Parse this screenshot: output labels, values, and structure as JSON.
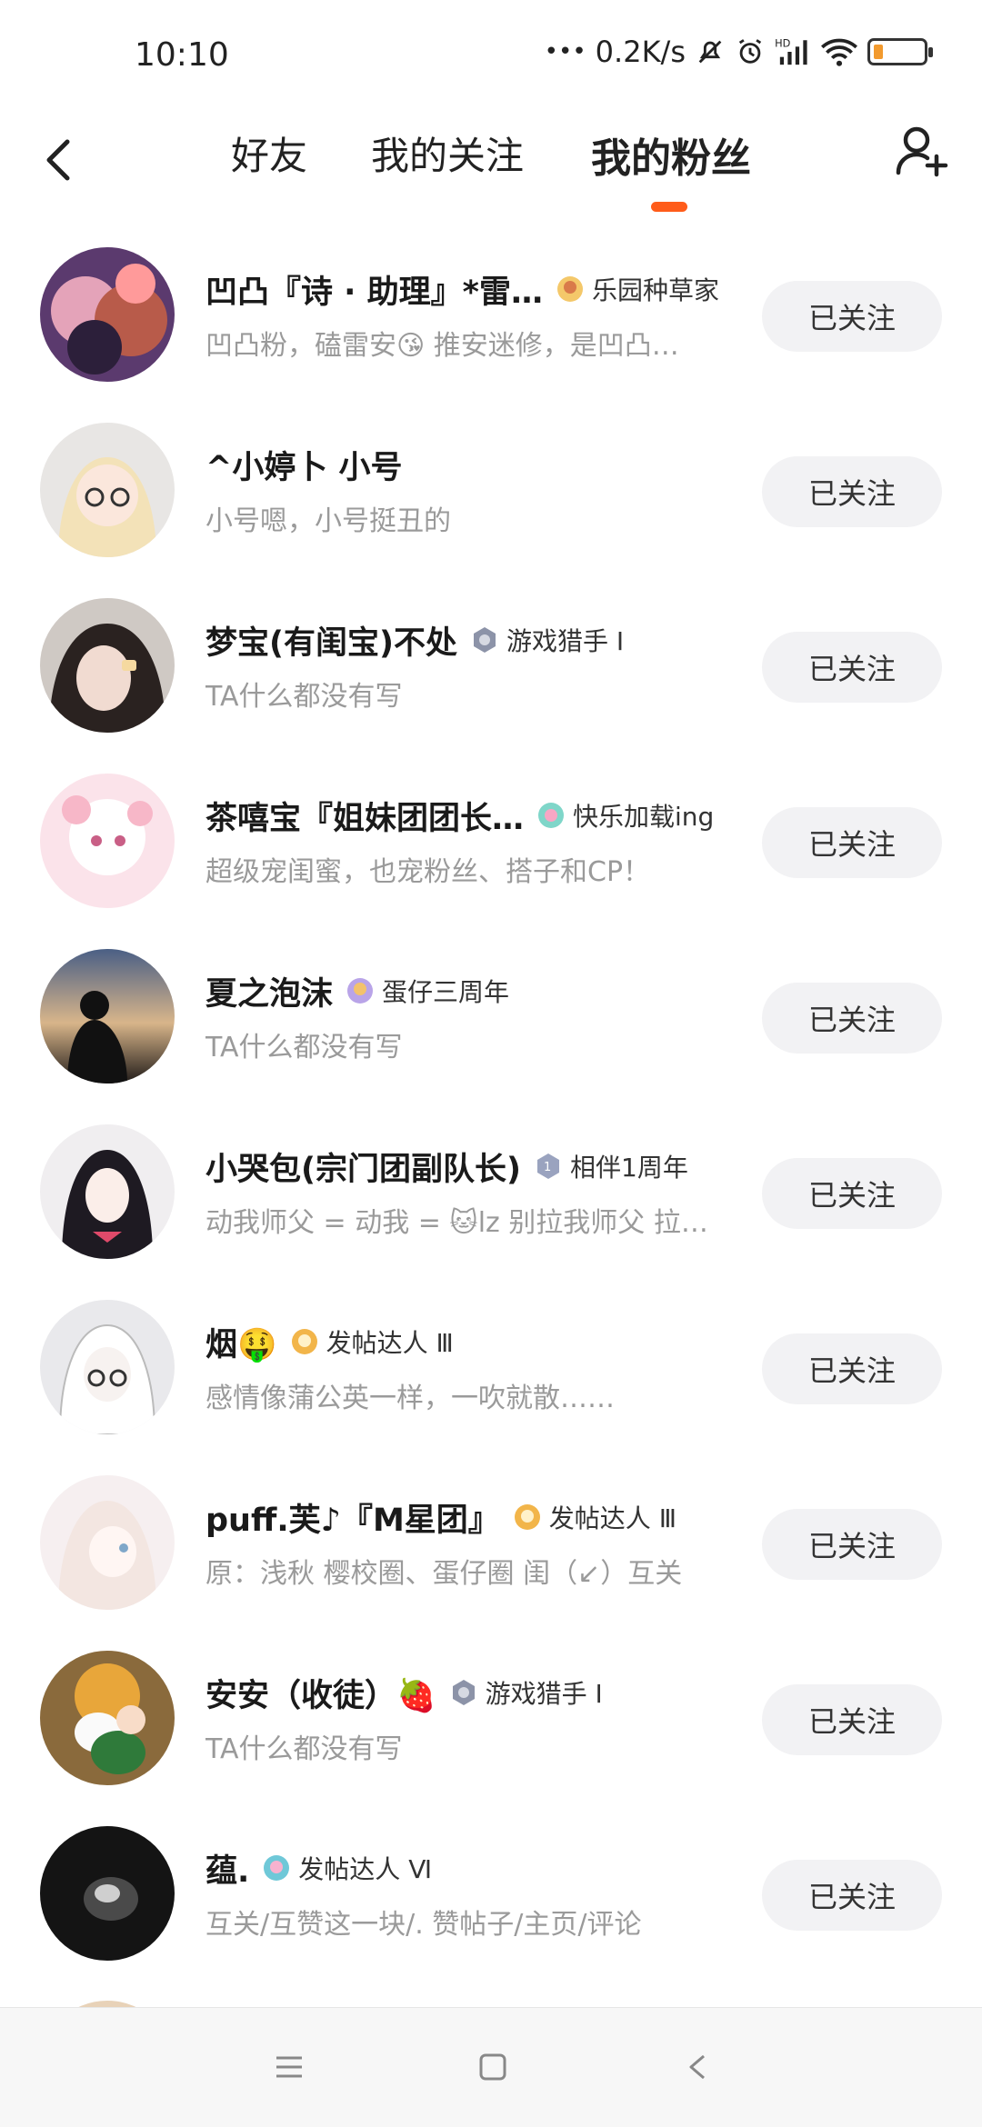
{
  "status_bar": {
    "time": "10:10",
    "speed": "0.2K/s",
    "dots": "•••",
    "icons": [
      "mute-icon",
      "alarm-icon",
      "signal-hd-icon",
      "wifi-icon",
      "battery-icon"
    ]
  },
  "header": {
    "back_icon": "chevron-left-icon",
    "tabs": [
      {
        "label": "好友",
        "active": false
      },
      {
        "label": "我的关注",
        "active": false
      },
      {
        "label": "我的粉丝",
        "active": true
      }
    ],
    "add_friend_icon": "add-user-icon",
    "accent_color": "#ff5c1a"
  },
  "fans": [
    {
      "name": "凹凸『诗 · 助理』*雷…",
      "medal": "乐园种草家",
      "bio": "凹凸粉，磕雷安😘 推安迷修，是凹凸…",
      "button": "已关注"
    },
    {
      "name": "^小婷卜 小号",
      "medal": "",
      "bio": "小号嗯，小号挺丑的",
      "button": "已关注"
    },
    {
      "name": "梦宝(有闺宝)不处",
      "medal": "游戏猎手 Ⅰ",
      "bio": "TA什么都没有写",
      "button": "已关注"
    },
    {
      "name": "茶嘻宝『姐妹团团长…",
      "medal": "快乐加载ing",
      "bio": "超级宠闺蜜，也宠粉丝、搭子和CP！",
      "button": "已关注"
    },
    {
      "name": "夏之泡沫",
      "medal": "蛋仔三周年",
      "bio": "TA什么都没有写",
      "button": "已关注"
    },
    {
      "name": "小哭包(宗门团副队长)",
      "medal": "相伴1周年",
      "bio": "动我师父 = 动我 = 🐱lz 别拉我师父 拉…",
      "button": "已关注"
    },
    {
      "name": "烟🤑",
      "medal": "发帖达人 Ⅲ",
      "bio": "感情像蒲公英一样，一吹就散……",
      "button": "已关注"
    },
    {
      "name": " puff.芙♪『M星团』",
      "medal": "发帖达人 Ⅲ",
      "bio": "原：浅秋 樱校圈、蛋仔圈 闺（↙）互关",
      "button": "已关注"
    },
    {
      "name": "安安（收徒）🍓",
      "medal": "游戏猎手 Ⅰ",
      "bio": "TA什么都没有写",
      "button": "已关注"
    },
    {
      "name": "蕴.",
      "medal": "发帖达人 Ⅵ",
      "bio": "互关/互赞这一块/. 赞帖子/主页/评论",
      "button": "已关注"
    }
  ],
  "nav_bar": {
    "icons": [
      "menu-icon",
      "home-square-icon",
      "back-triangle-icon"
    ]
  }
}
